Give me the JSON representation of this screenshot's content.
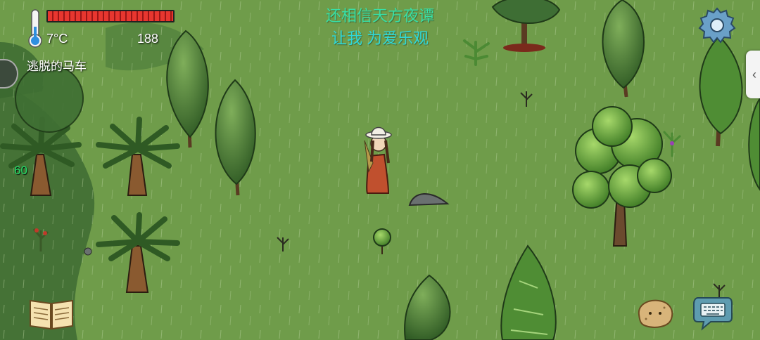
{
  "hud": {
    "health_fraction": 1.0,
    "temperature": "7°C",
    "counter": "188",
    "location_name": "逃脱的马车",
    "left_number": "60"
  },
  "chat": {
    "line1": "还相信天方夜谭",
    "line2": "让我 为爱乐观",
    "line1_color": "#38e0a6",
    "line2_color": "#2fd8d8"
  },
  "icons": {
    "settings": "gear-icon",
    "journal": "open-book-icon",
    "emote": "potato-icon",
    "chat_input": "keyboard-icon",
    "side_panel": "chevron-left-icon",
    "thermometer": "thermometer-icon"
  },
  "colors": {
    "grass": "#6e9a48",
    "grass_dark": "#3f6a32",
    "health_red": "#e8362f"
  }
}
